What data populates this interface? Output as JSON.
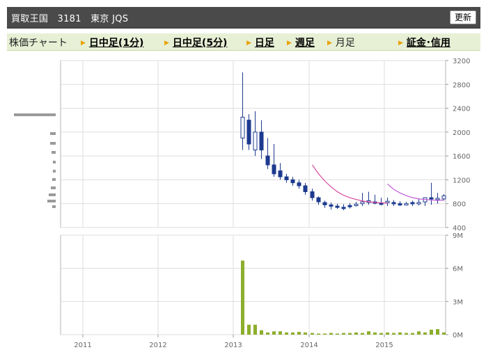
{
  "header": {
    "title": "買取王国　3181　東京 JQS",
    "refresh_label": "更新"
  },
  "nav": {
    "label_chart": "株価チャート",
    "items": [
      {
        "label": "日中足(1分)",
        "link": true
      },
      {
        "label": "日中足(5分)",
        "link": true
      },
      {
        "label": "日足",
        "link": true
      },
      {
        "label": "週足",
        "link": true
      },
      {
        "label": "月足",
        "link": false
      },
      {
        "label": "証金･信用",
        "link": true
      }
    ]
  },
  "chart_data": [
    {
      "type": "candlestick",
      "x": [
        "2013-02",
        "2013-03",
        "2013-04",
        "2013-05",
        "2013-06",
        "2013-07",
        "2013-08",
        "2013-09",
        "2013-10",
        "2013-11",
        "2013-12",
        "2014-01",
        "2014-02",
        "2014-03",
        "2014-04",
        "2014-05",
        "2014-06",
        "2014-07",
        "2014-08",
        "2014-09",
        "2014-10",
        "2014-11",
        "2014-12",
        "2015-01",
        "2015-02",
        "2015-03",
        "2015-04",
        "2015-05",
        "2015-06",
        "2015-07",
        "2015-08",
        "2015-09",
        "2015-10"
      ],
      "open": [
        1900,
        2200,
        1700,
        2000,
        1600,
        1450,
        1350,
        1250,
        1200,
        1150,
        1100,
        1000,
        900,
        820,
        780,
        760,
        740,
        770,
        780,
        800,
        820,
        830,
        810,
        820,
        820,
        800,
        790,
        820,
        810,
        830,
        900,
        870,
        880
      ],
      "high": [
        3000,
        2300,
        2350,
        2200,
        1900,
        1800,
        1480,
        1300,
        1250,
        1200,
        1150,
        1050,
        920,
        850,
        820,
        800,
        790,
        810,
        830,
        980,
        1000,
        950,
        900,
        900,
        860,
        840,
        830,
        850,
        880,
        900,
        1150,
        980,
        960
      ],
      "low": [
        1700,
        1700,
        1600,
        1550,
        1380,
        1250,
        1200,
        1150,
        1100,
        1050,
        950,
        850,
        780,
        730,
        700,
        710,
        690,
        720,
        750,
        760,
        780,
        790,
        770,
        760,
        760,
        760,
        770,
        760,
        770,
        760,
        780,
        800,
        850
      ],
      "close": [
        2250,
        1800,
        2000,
        1700,
        1450,
        1300,
        1250,
        1200,
        1150,
        1100,
        1000,
        900,
        830,
        780,
        760,
        750,
        730,
        760,
        790,
        830,
        850,
        820,
        800,
        840,
        800,
        790,
        800,
        810,
        820,
        900,
        880,
        890,
        930
      ],
      "moving_average_1": {
        "x_start": "2014-01",
        "values": [
          1450,
          1300,
          1180,
          1080,
          1000,
          940,
          900,
          870,
          845,
          830,
          820,
          815,
          810
        ]
      },
      "moving_average_2": {
        "x_start": "2015-01",
        "values": [
          1130,
          1040,
          980,
          935,
          900,
          880,
          870,
          860,
          855,
          860
        ]
      },
      "ylim": [
        400,
        3200
      ],
      "yticks": [
        "3200",
        "2800",
        "2400",
        "2000",
        "1600",
        "1200",
        "800",
        "400"
      ]
    },
    {
      "type": "bar",
      "x": [
        "2013-02",
        "2013-03",
        "2013-04",
        "2013-05",
        "2013-06",
        "2013-07",
        "2013-08",
        "2013-09",
        "2013-10",
        "2013-11",
        "2013-12",
        "2014-01",
        "2014-02",
        "2014-03",
        "2014-04",
        "2014-05",
        "2014-06",
        "2014-07",
        "2014-08",
        "2014-09",
        "2014-10",
        "2014-11",
        "2014-12",
        "2015-01",
        "2015-02",
        "2015-03",
        "2015-04",
        "2015-05",
        "2015-06",
        "2015-07",
        "2015-08",
        "2015-09",
        "2015-10"
      ],
      "values": [
        6.7,
        0.9,
        0.9,
        0.4,
        0.2,
        0.3,
        0.3,
        0.2,
        0.2,
        0.25,
        0.2,
        0.15,
        0.1,
        0.1,
        0.15,
        0.1,
        0.15,
        0.15,
        0.2,
        0.15,
        0.3,
        0.2,
        0.15,
        0.2,
        0.15,
        0.2,
        0.15,
        0.15,
        0.3,
        0.2,
        0.45,
        0.5,
        0.2
      ],
      "ylim": [
        0,
        9
      ],
      "yticks": [
        "9M",
        "6M",
        "3M",
        "0M"
      ],
      "xticks": [
        "2011",
        "2012",
        "2013",
        "2014",
        "2015"
      ]
    }
  ],
  "colors": {
    "bear": "#1d3a8f",
    "bull": "#ffffff",
    "ma1": "#d94aa0",
    "ma2": "#c15ad8",
    "volume": "#8cae2c",
    "grid": "#dddddd"
  }
}
